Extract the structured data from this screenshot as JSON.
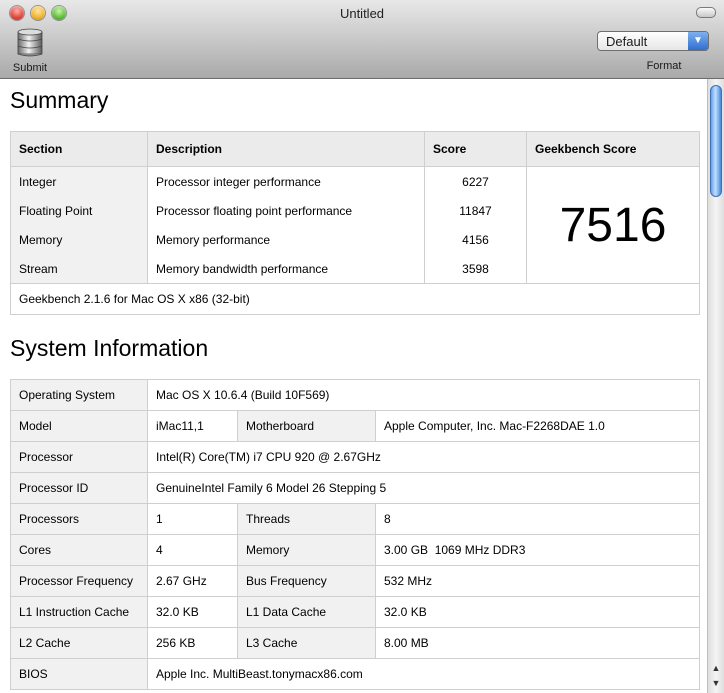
{
  "window": {
    "title": "Untitled"
  },
  "toolbar": {
    "submit_label": "Submit",
    "format_label": "Format",
    "format_selected": "Default"
  },
  "summary": {
    "heading": "Summary",
    "headers": {
      "section": "Section",
      "description": "Description",
      "score": "Score",
      "geekbench": "Geekbench Score"
    },
    "rows": [
      {
        "section": "Integer",
        "description": "Processor integer performance",
        "score": "6227"
      },
      {
        "section": "Floating Point",
        "description": "Processor floating point performance",
        "score": "11847"
      },
      {
        "section": "Memory",
        "description": "Memory performance",
        "score": "4156"
      },
      {
        "section": "Stream",
        "description": "Memory bandwidth performance",
        "score": "3598"
      }
    ],
    "geekbench_score": "7516",
    "footer": "Geekbench 2.1.6 for Mac OS X x86 (32-bit)"
  },
  "sysinfo": {
    "heading": "System Information",
    "os_label": "Operating System",
    "os_value": "Mac OS X 10.6.4 (Build 10F569)",
    "model_label": "Model",
    "model_value": "iMac11,1",
    "motherboard_label": "Motherboard",
    "motherboard_value": "Apple Computer, Inc. Mac-F2268DAE 1.0",
    "processor_label": "Processor",
    "processor_value": "Intel(R) Core(TM) i7 CPU 920 @ 2.67GHz",
    "processor_id_label": "Processor ID",
    "processor_id_value": "GenuineIntel Family 6 Model 26 Stepping 5",
    "processors_label": "Processors",
    "processors_value": "1",
    "threads_label": "Threads",
    "threads_value": "8",
    "cores_label": "Cores",
    "cores_value": "4",
    "memory_label": "Memory",
    "memory_value": "3.00 GB  1069 MHz DDR3",
    "freq_label": "Processor Frequency",
    "freq_value": "2.67 GHz",
    "bus_label": "Bus Frequency",
    "bus_value": "532 MHz",
    "l1i_label": "L1 Instruction Cache",
    "l1i_value": "32.0 KB",
    "l1d_label": "L1 Data Cache",
    "l1d_value": "32.0 KB",
    "l2_label": "L2 Cache",
    "l2_value": "256 KB",
    "l3_label": "L3 Cache",
    "l3_value": "8.00 MB",
    "bios_label": "BIOS",
    "bios_value": "Apple Inc. MultiBeast.tonymacx86.com"
  },
  "icons": {
    "close": "close-button",
    "minimize": "minimize-button",
    "zoom": "zoom-button",
    "submit": "database-icon",
    "select_arrow": "chevron-down-icon"
  }
}
